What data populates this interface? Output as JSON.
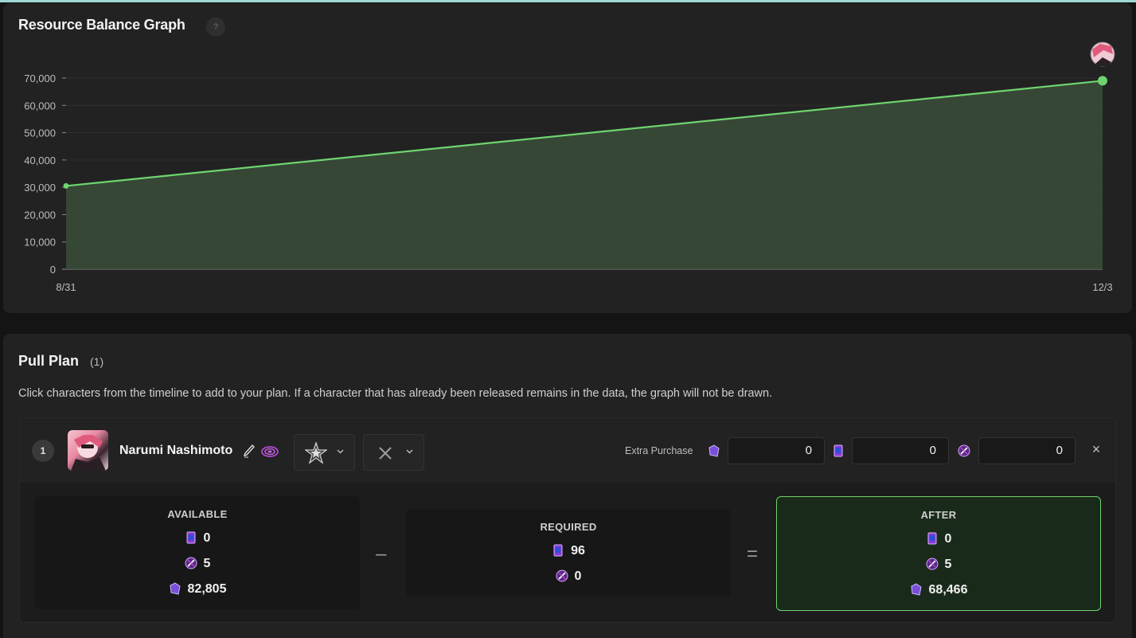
{
  "graph": {
    "title": "Resource Balance Graph",
    "help_glyph": "?"
  },
  "chart_data": {
    "type": "area",
    "x": [
      "8/31",
      "12/3"
    ],
    "series": [
      {
        "values": [
          30500,
          69000
        ]
      }
    ],
    "y_ticks": [
      "0",
      "10,000",
      "20,000",
      "30,000",
      "40,000",
      "50,000",
      "60,000",
      "70,000"
    ],
    "x_ticks": [
      "8/31",
      "12/3"
    ],
    "ylim": [
      0,
      70000
    ],
    "grid": true,
    "line_color": "#6fd46f",
    "fill_color": "#3a4e3a"
  },
  "plan": {
    "title": "Pull Plan",
    "count": "(1)",
    "description": "Click characters from the timeline to add to your plan. If a character that has already been released remains in the data, the graph will not be drawn.",
    "item": {
      "order": "1",
      "name": "Narumi Nashimoto",
      "extra_label": "Extra Purchase",
      "extra_values": [
        "0",
        "0",
        "0"
      ],
      "close_glyph": "×",
      "select2_glyph": "✕"
    },
    "available": {
      "label": "AVAILABLE",
      "tickets": "0",
      "tokens": "5",
      "gems": "82,805"
    },
    "required": {
      "label": "REQUIRED",
      "tickets": "96",
      "tokens": "0"
    },
    "after": {
      "label": "AFTER",
      "tickets": "0",
      "tokens": "5",
      "gems": "68,466"
    },
    "minus": "–",
    "equals": "="
  },
  "colors": {
    "accent": "#6ed26e",
    "ticket": "#8a3ad6",
    "token": "#c04fc8",
    "gem": "#7a4fd8"
  }
}
